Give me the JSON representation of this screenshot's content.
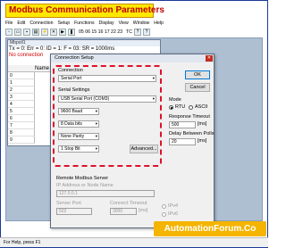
{
  "banner": {
    "title": "Modbus Communication Parameters"
  },
  "menu": [
    "File",
    "Edit",
    "Connection",
    "Setup",
    "Functions",
    "Display",
    "View",
    "Window",
    "Help"
  ],
  "toolbar": {
    "codes": "05 06 15 16 17 22 23",
    "tc": "TC"
  },
  "child_window": {
    "title": "Mbpoll1",
    "status": "Tx = 0: Err = 0: ID = 1: F = 03: SR = 1000ms",
    "connection": "No connection",
    "column_header": "Name",
    "rows": [
      "0",
      "1",
      "2",
      "3",
      "4",
      "5",
      "6",
      "7",
      "8",
      "9"
    ]
  },
  "dialog": {
    "title": "Connection Setup",
    "connection_label": "Connection",
    "connection_value": "Serial Port",
    "serial_label": "Serial Settings",
    "port": "USB Serial Port (COM3)",
    "baud": "9600 Baud",
    "data_bits": "8 Data bits",
    "parity": "None Parity",
    "stop_bits": "1 Stop Bit",
    "advanced": "Advanced...",
    "ok": "OK",
    "cancel": "Cancel",
    "mode_label": "Mode",
    "mode_rtu": "RTU",
    "mode_ascii": "ASCII",
    "response_label": "Response Timeout",
    "response_value": "500",
    "response_unit": "[ms]",
    "delay_label": "Delay Between Polls",
    "delay_value": "20",
    "delay_unit": "[ms]",
    "remote_label": "Remote Modbus Server",
    "ip_label": "IP Address or Node Name",
    "ip_value": "127.0.0.1",
    "server_port_label": "Server Port",
    "server_port_value": "502",
    "connect_timeout_label": "Connect Timeout",
    "connect_timeout_value": "3000",
    "connect_timeout_unit": "[ms]",
    "ipv4": "IPv4",
    "ipv6": "IPv6"
  },
  "statusbar": "For Help, press F1",
  "watermark": "AutomationForum.Co"
}
